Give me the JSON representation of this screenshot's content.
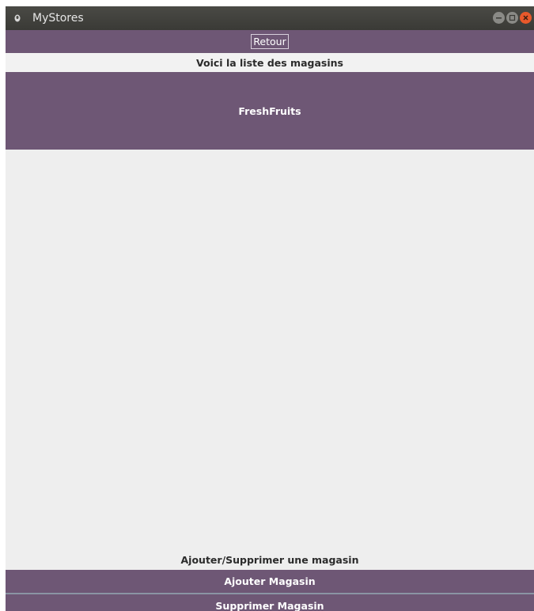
{
  "window": {
    "title": "MyStores",
    "controls": [
      "minimize-icon",
      "maximize-icon",
      "close-icon"
    ]
  },
  "toolbar": {
    "retour_label": "Retour"
  },
  "page": {
    "heading": "Voici la liste des magasins"
  },
  "stores": [
    {
      "name": "FreshFruits"
    }
  ],
  "footer": {
    "label": "Ajouter/Supprimer une magasin",
    "add_label": "Ajouter Magasin",
    "remove_label": "Supprimer Magasin"
  },
  "colors": {
    "accent": "#6e5775",
    "titlebar": "#3c3b37",
    "background": "#eeeeee",
    "close_button": "#e9592b"
  }
}
